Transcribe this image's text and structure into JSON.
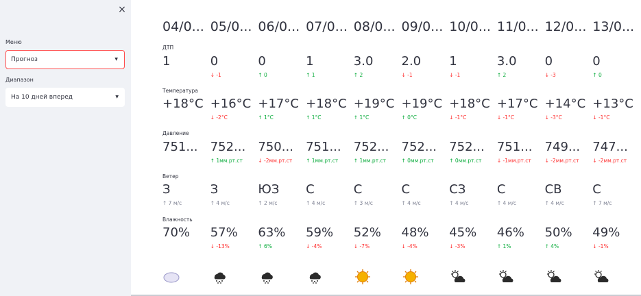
{
  "sidebar": {
    "close_glyph": "×",
    "menu_label": "Меню",
    "menu_value": "Прогноз",
    "range_label": "Диапазон",
    "range_value": "На 10 дней вперед",
    "caret_glyph": "▼"
  },
  "rows": {
    "dtp": "ДТП",
    "temp": "Температура",
    "pressure": "Давление",
    "wind": "Ветер",
    "humidity": "Влажность"
  },
  "days": [
    {
      "date": "04/0...",
      "dtp": "1",
      "dtp_d": "",
      "temp": "+18°C",
      "temp_d": "",
      "pres": "751...",
      "pres_d": "",
      "wind": "З",
      "wind_d": "↑ 7 м/с",
      "wind_dir": "neutral",
      "hum": "70%",
      "hum_d": "",
      "icon": "cloud-icon"
    },
    {
      "date": "05/0...",
      "dtp": "0",
      "dtp_d": "↓ -1",
      "dtp_dir": "down",
      "temp": "+16°C",
      "temp_d": "↓ -2°C",
      "temp_dir": "down",
      "pres": "752...",
      "pres_d": "↑ 1мм.рт.ст",
      "pres_dir": "up",
      "wind": "З",
      "wind_d": "↑ 4 м/с",
      "wind_dir": "neutral",
      "hum": "57%",
      "hum_d": "↓ -13%",
      "hum_dir": "down",
      "icon": "snow-icon"
    },
    {
      "date": "06/0...",
      "dtp": "0",
      "dtp_d": "↑ 0",
      "dtp_dir": "up",
      "temp": "+17°C",
      "temp_d": "↑ 1°C",
      "temp_dir": "up",
      "pres": "750...",
      "pres_d": "↓ -2мм.рт.ст",
      "pres_dir": "down",
      "wind": "ЮЗ",
      "wind_d": "↑ 2 м/с",
      "wind_dir": "neutral",
      "hum": "63%",
      "hum_d": "↑ 6%",
      "hum_dir": "up",
      "icon": "snow-icon"
    },
    {
      "date": "07/0...",
      "dtp": "1",
      "dtp_d": "↑ 1",
      "dtp_dir": "up",
      "temp": "+18°C",
      "temp_d": "↑ 1°C",
      "temp_dir": "up",
      "pres": "751...",
      "pres_d": "↑ 1мм.рт.ст",
      "pres_dir": "up",
      "wind": "С",
      "wind_d": "↑ 4 м/с",
      "wind_dir": "neutral",
      "hum": "59%",
      "hum_d": "↓ -4%",
      "hum_dir": "down",
      "icon": "snow-icon"
    },
    {
      "date": "08/0...",
      "dtp": "3.0",
      "dtp_d": "↑ 2",
      "dtp_dir": "up",
      "temp": "+19°C",
      "temp_d": "↑ 1°C",
      "temp_dir": "up",
      "pres": "752...",
      "pres_d": "↑ 1мм.рт.ст",
      "pres_dir": "up",
      "wind": "С",
      "wind_d": "↑ 3 м/с",
      "wind_dir": "neutral",
      "hum": "52%",
      "hum_d": "↓ -7%",
      "hum_dir": "down",
      "icon": "sun-icon"
    },
    {
      "date": "09/0...",
      "dtp": "2.0",
      "dtp_d": "↓ -1",
      "dtp_dir": "down",
      "temp": "+19°C",
      "temp_d": "↑ 0°C",
      "temp_dir": "up",
      "pres": "752...",
      "pres_d": "↑ 0мм.рт.ст",
      "pres_dir": "up",
      "wind": "С",
      "wind_d": "↑ 4 м/с",
      "wind_dir": "neutral",
      "hum": "48%",
      "hum_d": "↓ -4%",
      "hum_dir": "down",
      "icon": "sun-icon"
    },
    {
      "date": "10/0...",
      "dtp": "1",
      "dtp_d": "↓ -1",
      "dtp_dir": "down",
      "temp": "+18°C",
      "temp_d": "↓ -1°C",
      "temp_dir": "down",
      "pres": "752...",
      "pres_d": "↑ 0мм.рт.ст",
      "pres_dir": "up",
      "wind": "СЗ",
      "wind_d": "↑ 4 м/с",
      "wind_dir": "neutral",
      "hum": "45%",
      "hum_d": "↓ -3%",
      "hum_dir": "down",
      "icon": "partly-cloudy-icon"
    },
    {
      "date": "11/0...",
      "dtp": "3.0",
      "dtp_d": "↑ 2",
      "dtp_dir": "up",
      "temp": "+17°C",
      "temp_d": "↓ -1°C",
      "temp_dir": "down",
      "pres": "751...",
      "pres_d": "↓ -1мм.рт.ст",
      "pres_dir": "down",
      "wind": "С",
      "wind_d": "↑ 4 м/с",
      "wind_dir": "neutral",
      "hum": "46%",
      "hum_d": "↑ 1%",
      "hum_dir": "up",
      "icon": "partly-cloudy-icon"
    },
    {
      "date": "12/0...",
      "dtp": "0",
      "dtp_d": "↓ -3",
      "dtp_dir": "down",
      "temp": "+14°C",
      "temp_d": "↓ -3°C",
      "temp_dir": "down",
      "pres": "749...",
      "pres_d": "↓ -2мм.рт.ст",
      "pres_dir": "down",
      "wind": "СВ",
      "wind_d": "↑ 4 м/с",
      "wind_dir": "neutral",
      "hum": "50%",
      "hum_d": "↑ 4%",
      "hum_dir": "up",
      "icon": "partly-cloudy-icon"
    },
    {
      "date": "13/0...",
      "dtp": "0",
      "dtp_d": "↑ 0",
      "dtp_dir": "up",
      "temp": "+13°C",
      "temp_d": "↓ -1°C",
      "temp_dir": "down",
      "pres": "747...",
      "pres_d": "↓ -2мм.рт.ст",
      "pres_dir": "down",
      "wind": "С",
      "wind_d": "↑ 7 м/с",
      "wind_dir": "neutral",
      "hum": "49%",
      "hum_d": "↓ -1%",
      "hum_dir": "down",
      "icon": "partly-cloudy-icon"
    }
  ],
  "colors": {
    "accent": "#ff4b4b",
    "up": "#09ab3b",
    "down": "#ff2b2b",
    "sidebar_bg": "#f0f2f6"
  }
}
